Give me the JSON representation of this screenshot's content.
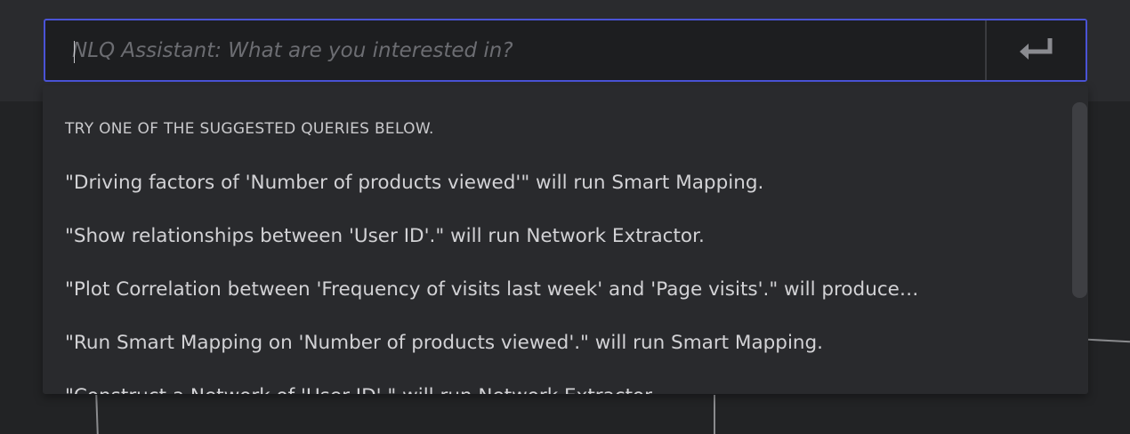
{
  "search": {
    "placeholder": "NLQ Assistant: What are you interested in?",
    "value": ""
  },
  "submit": {
    "icon": "enter-return-icon"
  },
  "dropdown": {
    "hint": "TRY ONE OF THE SUGGESTED QUERIES BELOW.",
    "suggestions": [
      "\"Driving factors of 'Number of products viewed'\" will run Smart Mapping.",
      "\"Show relationships between 'User ID'.\" will run Network Extractor.",
      "\"Plot Correlation between 'Frequency of visits last week' and 'Page visits'.\" will produce…",
      "\"Run Smart Mapping on 'Number of products viewed'.\" will run Smart Mapping.",
      "\"Construct a Network of 'User ID'.\" will run Network Extractor."
    ]
  },
  "colors": {
    "accent": "#4a53d6",
    "background": "#222325",
    "panel": "#292a2d"
  }
}
